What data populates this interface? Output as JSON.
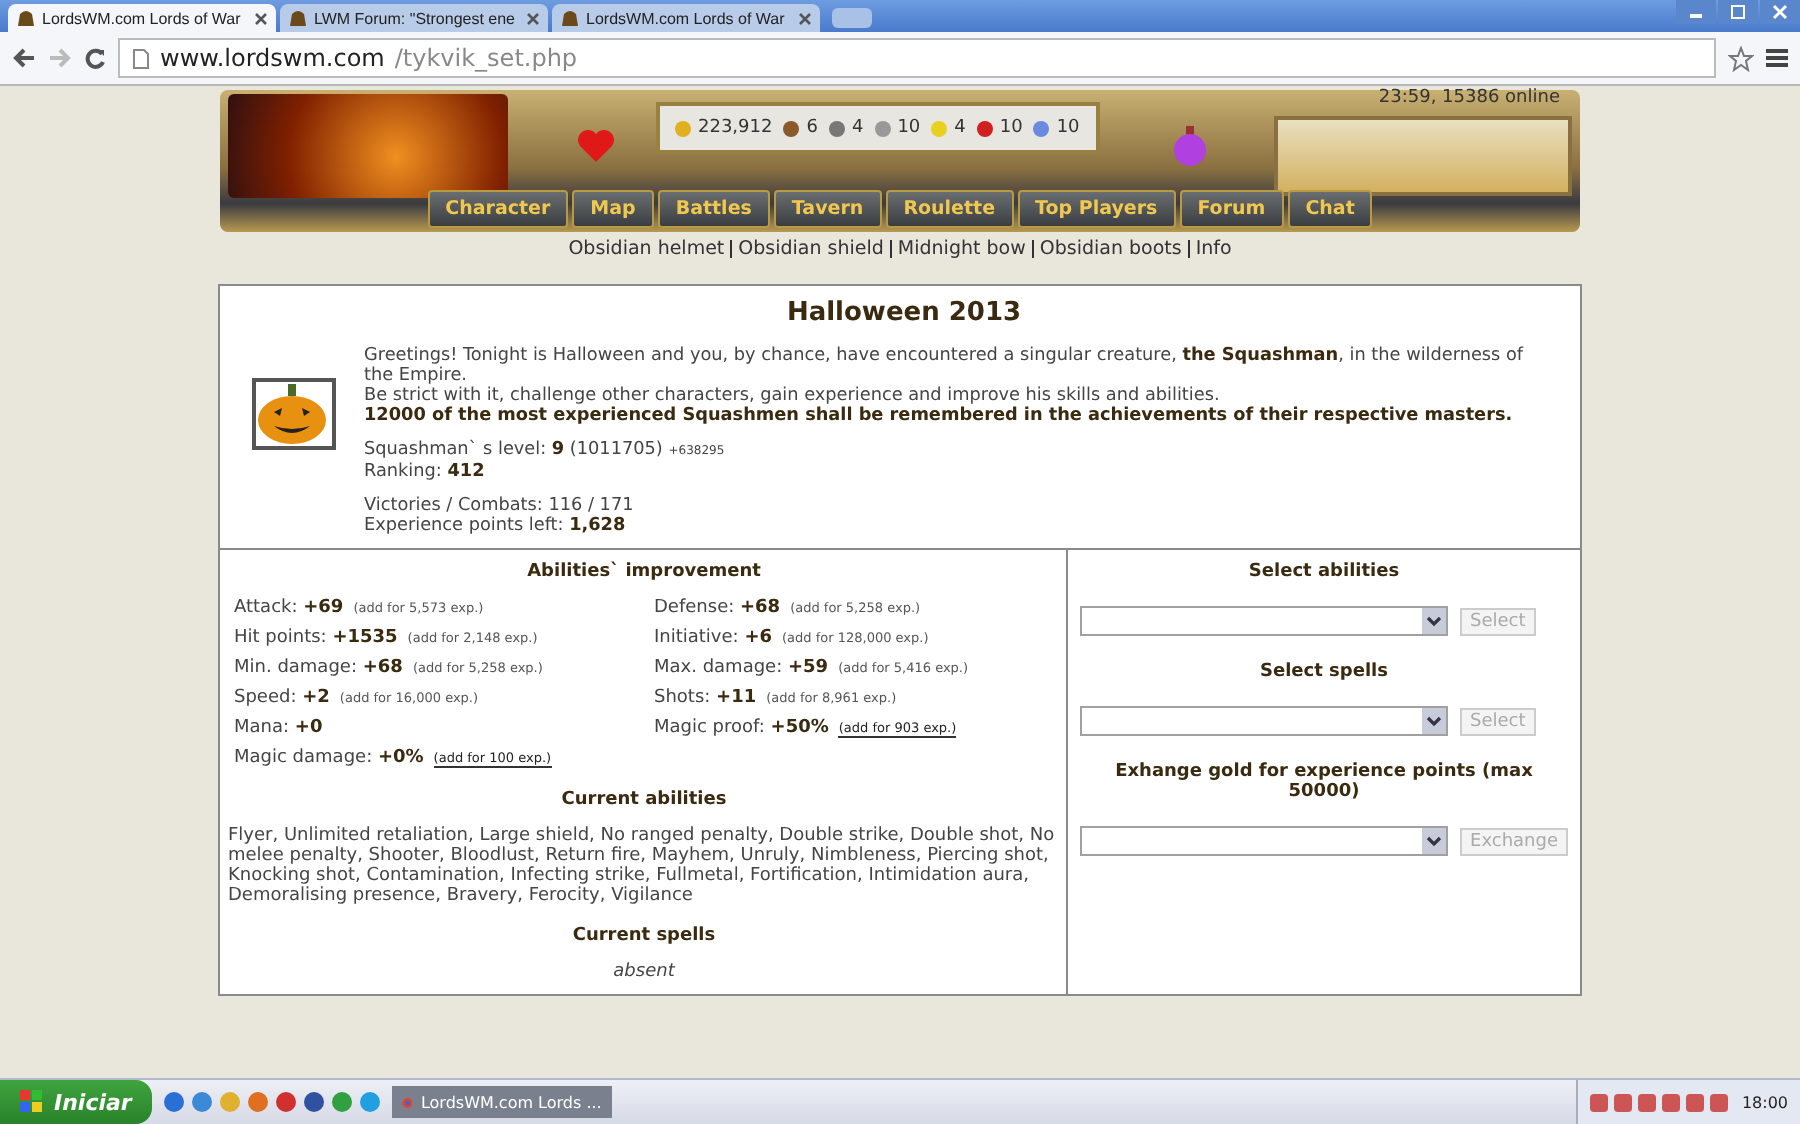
{
  "browser": {
    "tabs": [
      {
        "title": "LordsWM.com Lords of War",
        "selected": true
      },
      {
        "title": "LWM Forum: \"Strongest ene",
        "selected": false
      },
      {
        "title": "LordsWM.com Lords of War",
        "selected": false
      }
    ],
    "url": {
      "host": "www.lordswm.com",
      "path": "/tykvik_set.php"
    }
  },
  "header": {
    "resources": [
      {
        "kind": "gold",
        "value": "223,912"
      },
      {
        "kind": "wood",
        "value": "6"
      },
      {
        "kind": "ore",
        "value": "4"
      },
      {
        "kind": "mercury",
        "value": "10"
      },
      {
        "kind": "sulfur",
        "value": "4"
      },
      {
        "kind": "crystal",
        "value": "10"
      },
      {
        "kind": "gems",
        "value": "10"
      }
    ],
    "status": "23:59, 15386 online",
    "nav": [
      "Character",
      "Map",
      "Battles",
      "Tavern",
      "Roulette",
      "Top Players",
      "Forum",
      "Chat"
    ],
    "links": [
      "Obsidian helmet",
      "Obsidian shield",
      "Midnight bow",
      "Obsidian boots",
      "Info"
    ]
  },
  "event": {
    "title": "Halloween 2013",
    "intro": [
      "Greetings! Tonight is Halloween and you, by chance, have encountered a singular creature, **the Squashman**, in the wilderness of the Empire.",
      "Be strict with it, challenge other characters, gain experience and improve his skills and abilities.",
      "**12000 of the most experienced Squashmen shall be remembered in the achievements of their respective masters.**"
    ],
    "level": {
      "text": "Squashman` s level: **9** (1011705)",
      "extra": "+638295"
    },
    "ranking": "Ranking: **412**",
    "victories": "Victories / Combats: 116 / 171",
    "experience": "Experience points left: **1,628**"
  },
  "abilities": {
    "title": "Abilities` improvement",
    "items": [
      {
        "label": "Attack: **+69**",
        "add": "(add for 5,573 exp.)",
        "linked": false
      },
      {
        "label": "Defense: **+68**",
        "add": "(add for 5,258 exp.)",
        "linked": false
      },
      {
        "label": "Hit points: **+1535**",
        "add": "(add for 2,148 exp.)",
        "linked": false
      },
      {
        "label": "Initiative: **+6**",
        "add": "(add for 128,000 exp.)",
        "linked": false
      },
      {
        "label": "Min. damage: **+68**",
        "add": "(add for 5,258 exp.)",
        "linked": false
      },
      {
        "label": "Max. damage: **+59**",
        "add": "(add for 5,416 exp.)",
        "linked": false
      },
      {
        "label": "Speed: **+2**",
        "add": "(add for 16,000 exp.)",
        "linked": false
      },
      {
        "label": "Shots: **+11**",
        "add": "(add for 8,961 exp.)",
        "linked": false
      },
      {
        "label": "Mana: **+0**"
      },
      {
        "label": "Magic proof: **+50%**",
        "add": "(add for 903 exp.)",
        "linked": true
      },
      {
        "label": "Magic damage: **+0%**",
        "add": "(add for 100 exp.)",
        "linked": true
      }
    ],
    "current_title": "Current abilities",
    "current": "Flyer, Unlimited retaliation, Large shield, No ranged penalty, Double strike, Double shot, No melee penalty, Shooter, Bloodlust, Return fire, Mayhem, Unruly, Nimbleness, Piercing shot, Knocking shot, Contamination, Infecting strike, Fullmetal, Fortification, Intimidation aura, Demoralising presence, Bravery, Ferocity, Vigilance",
    "spells_title": "Current spells",
    "spells": "absent"
  },
  "selects": [
    {
      "title": "Select abilities",
      "button": "Select",
      "disabled": true
    },
    {
      "title": "Select spells",
      "button": "Select",
      "disabled": true
    },
    {
      "title": "Exhange gold for experience points (max 50000)",
      "button": "Exchange",
      "disabled": true
    }
  ],
  "taskbar": {
    "start": "Iniciar",
    "window": "LordsWM.com Lords ...",
    "clock": "18:00"
  }
}
